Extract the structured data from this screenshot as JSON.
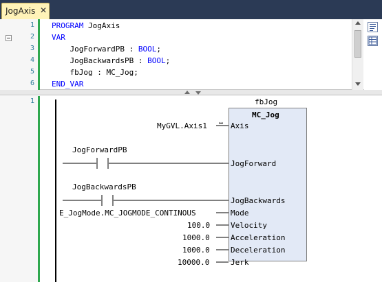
{
  "tab": {
    "label": "JogAxis",
    "close": "✕"
  },
  "declaration": {
    "line_numbers": [
      "1",
      "2",
      "3",
      "4",
      "5",
      "6"
    ],
    "lines": [
      {
        "parts": [
          {
            "text": "PROGRAM",
            "kw": true
          },
          {
            "text": " JogAxis",
            "kw": false
          }
        ]
      },
      {
        "parts": [
          {
            "text": "VAR",
            "kw": true
          }
        ]
      },
      {
        "parts": [
          {
            "text": "    JogForwardPB : ",
            "kw": false
          },
          {
            "text": "BOOL",
            "kw": true
          },
          {
            "text": ";",
            "kw": false
          }
        ]
      },
      {
        "parts": [
          {
            "text": "    JogBackwardsPB : ",
            "kw": false
          },
          {
            "text": "BOOL",
            "kw": true
          },
          {
            "text": ";",
            "kw": false
          }
        ]
      },
      {
        "parts": [
          {
            "text": "    fbJog : MC_Jog;",
            "kw": false
          }
        ]
      },
      {
        "parts": [
          {
            "text": "END_VAR",
            "kw": true
          }
        ]
      }
    ]
  },
  "network": {
    "number": "1",
    "instance_name": "fbJog",
    "fb_type": "MC_Jog",
    "contacts": [
      {
        "name": "JogForwardPB"
      },
      {
        "name": "JogBackwardsPB"
      }
    ],
    "inputs": [
      {
        "pin": "Axis",
        "value": "MyGVL.Axis1",
        "inout": true
      },
      {
        "pin": "JogForward",
        "value": ""
      },
      {
        "pin": "JogBackwards",
        "value": ""
      },
      {
        "pin": "Mode",
        "value": "E_JogMode.MC_JOGMODE_CONTINOUS"
      },
      {
        "pin": "Velocity",
        "value": "100.0"
      },
      {
        "pin": "Acceleration",
        "value": "1000.0"
      },
      {
        "pin": "Deceleration",
        "value": "1000.0"
      },
      {
        "pin": "Jerk",
        "value": "10000.0"
      }
    ],
    "inout_symbol": "↔"
  }
}
